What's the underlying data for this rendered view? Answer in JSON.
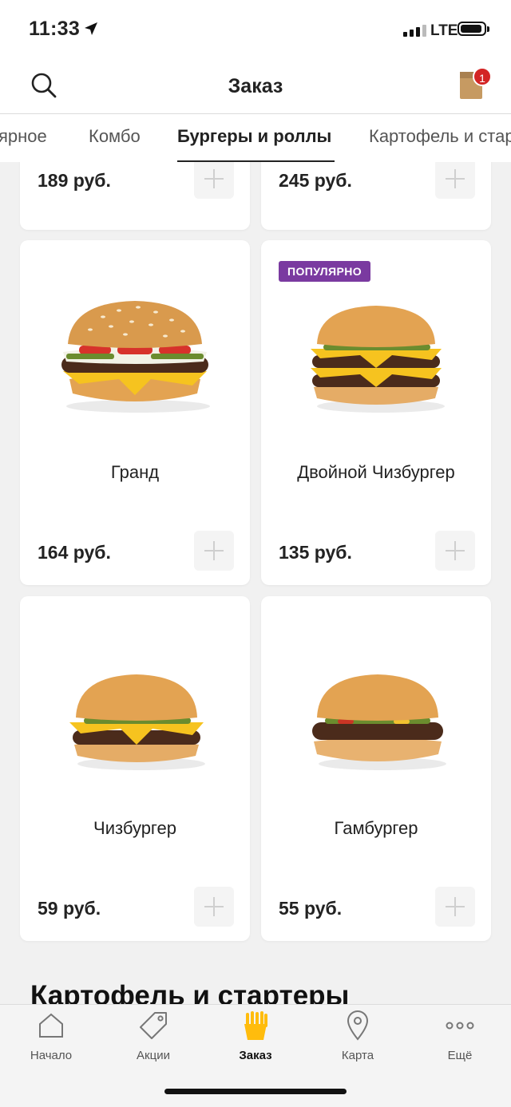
{
  "status_bar": {
    "time": "11:33",
    "network": "LTE"
  },
  "header": {
    "title": "Заказ",
    "cart_count": "1"
  },
  "tabs": [
    "ярное",
    "Комбо",
    "Бургеры и роллы",
    "Картофель и стартеры"
  ],
  "active_tab": "Бургеры и роллы",
  "top_row_prices": [
    "189 руб.",
    "245 руб."
  ],
  "products": [
    {
      "name": "Гранд",
      "price": "164 руб.",
      "badge": ""
    },
    {
      "name": "Двойной Чизбургер",
      "price": "135 руб.",
      "badge": "ПОПУЛЯРНО"
    },
    {
      "name": "Чизбургер",
      "price": "59 руб.",
      "badge": ""
    },
    {
      "name": "Гамбургер",
      "price": "55 руб.",
      "badge": ""
    }
  ],
  "next_section_title": "Картофель и стартеры",
  "bottom_nav": [
    {
      "label": "Начало",
      "icon": "home-icon"
    },
    {
      "label": "Акции",
      "icon": "tag-icon"
    },
    {
      "label": "Заказ",
      "icon": "fries-icon"
    },
    {
      "label": "Карта",
      "icon": "map-pin-icon"
    },
    {
      "label": "Ещё",
      "icon": "more-icon"
    }
  ],
  "colors": {
    "accent": "#ffbc0d",
    "badge": "#7a3aa0",
    "cart_badge": "#d32424"
  }
}
